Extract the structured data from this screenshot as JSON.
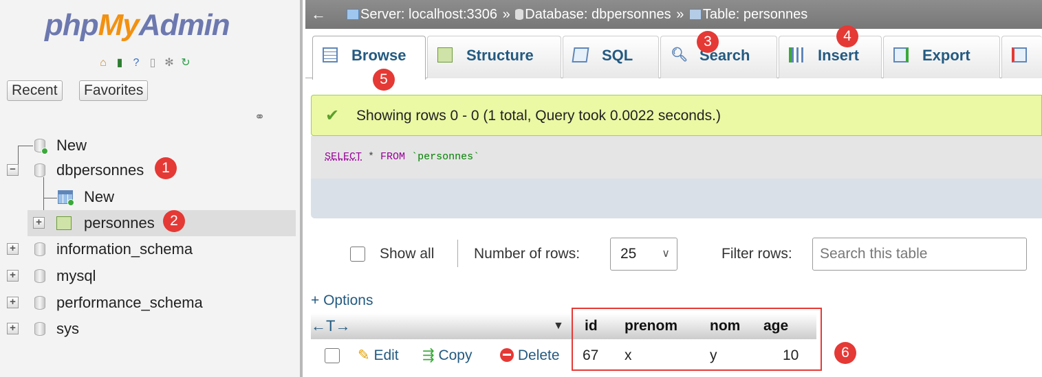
{
  "app": {
    "logo": {
      "php": "php",
      "my": "My",
      "admin": "Admin"
    },
    "buttons": {
      "recent": "Recent",
      "favorites": "Favorites"
    }
  },
  "tree": [
    {
      "label": "New",
      "icon": "new-db-icon"
    },
    {
      "label": "dbpersonnes",
      "icon": "database-icon",
      "badge": "1"
    },
    {
      "label": "New",
      "icon": "new-table-icon"
    },
    {
      "label": "personnes",
      "icon": "table-icon",
      "badge": "2"
    },
    {
      "label": "information_schema",
      "icon": "database-icon"
    },
    {
      "label": "mysql",
      "icon": "database-icon"
    },
    {
      "label": "performance_schema",
      "icon": "database-icon"
    },
    {
      "label": "sys",
      "icon": "database-icon"
    }
  ],
  "breadcrumb": {
    "back": "←",
    "server": "Server: localhost:3306",
    "sep": "»",
    "database": "Database: dbpersonnes",
    "table": "Table: personnes"
  },
  "tabs": [
    {
      "label": "Browse",
      "badge": "5"
    },
    {
      "label": "Structure"
    },
    {
      "label": "SQL"
    },
    {
      "label": "Search",
      "badge": "3"
    },
    {
      "label": "Insert",
      "badge": "4"
    },
    {
      "label": "Export"
    }
  ],
  "message": {
    "text": "Showing rows 0 - 0 (1 total, Query took 0.0022 seconds.)"
  },
  "query": {
    "select": "SELECT",
    "star": " * ",
    "from": "FROM",
    "table": "`personnes`"
  },
  "controls": {
    "show_all": "Show all",
    "rows_label": "Number of rows:",
    "rows_value": "25",
    "filter_label": "Filter rows:",
    "filter_placeholder": "Search this table",
    "options": "+ Options"
  },
  "table": {
    "arrows": "←T→",
    "columns": [
      "id",
      "prenom",
      "nom",
      "age"
    ],
    "row": {
      "edit": "Edit",
      "copy": "Copy",
      "delete": "Delete",
      "values": [
        "67",
        "x",
        "y",
        "10"
      ]
    },
    "badge": "6"
  },
  "colors": {
    "accent": "#235a81",
    "badge": "#e53935",
    "success_bg": "#ebf8a4"
  }
}
